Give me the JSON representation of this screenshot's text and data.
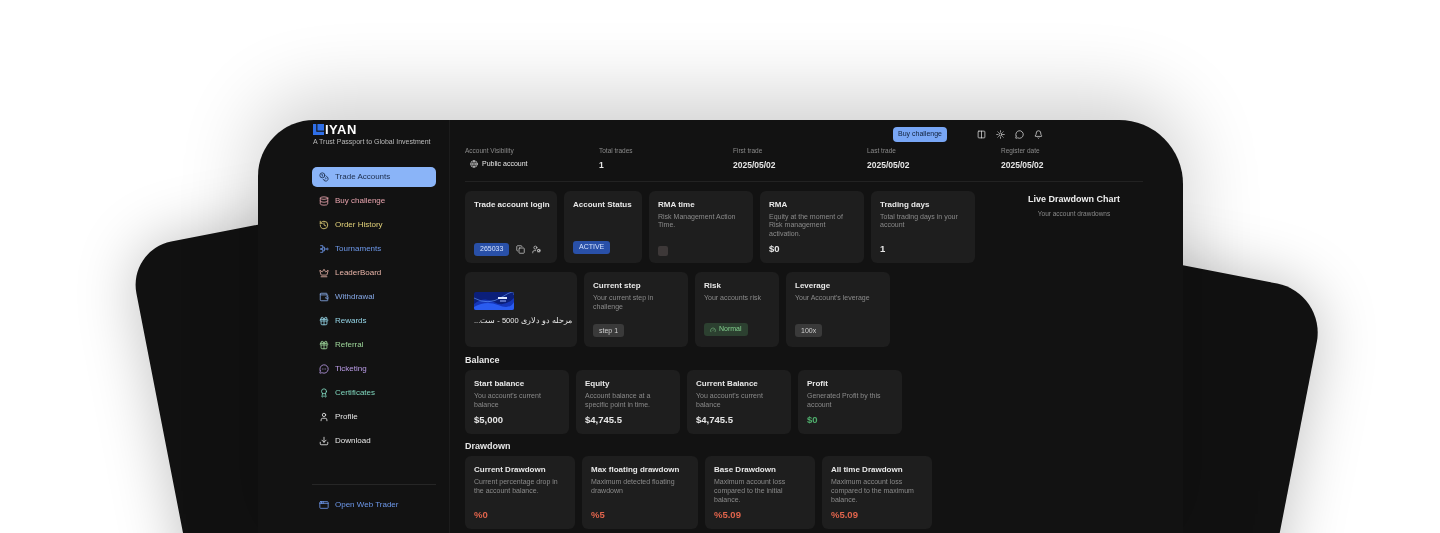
{
  "main": {
    "logo": {
      "name": "IYAN",
      "tagline": "A Trust Passport to Global Investment"
    },
    "sidebar": {
      "items": [
        {
          "label": "Trade Accounts",
          "selected": true
        },
        {
          "label": "Buy challenge",
          "selected": false
        },
        {
          "label": "Order History",
          "selected": false
        },
        {
          "label": "Tournaments",
          "selected": false
        },
        {
          "label": "LeaderBoard",
          "selected": false
        },
        {
          "label": "Withdrawal",
          "selected": false
        },
        {
          "label": "Rewards",
          "selected": false
        },
        {
          "label": "Referral",
          "selected": false
        },
        {
          "label": "Ticketing",
          "selected": false
        },
        {
          "label": "Certificates",
          "selected": false
        },
        {
          "label": "Profile",
          "selected": false
        },
        {
          "label": "Download",
          "selected": false
        }
      ],
      "footer": {
        "label": "Open Web Trader"
      }
    },
    "header": {
      "button": "Buy challenge"
    },
    "info": [
      {
        "kind": "visibility",
        "label": "Account Visibility",
        "value": "Public account"
      },
      {
        "kind": "text",
        "label": "Total trades",
        "value": "1"
      },
      {
        "kind": "text",
        "label": "First trade",
        "value": "2025/05/02"
      },
      {
        "kind": "text",
        "label": "Last trade",
        "value": "2025/05/02"
      },
      {
        "kind": "text",
        "label": "Register date",
        "value": "2025/05/02"
      }
    ],
    "cards_row_1": [
      {
        "kind": "login",
        "title": "Trade account login",
        "badge": "265033"
      },
      {
        "kind": "status",
        "title": "Account Status",
        "badge": "ACTIVE"
      },
      {
        "kind": "empty",
        "title": "RMA time",
        "description": "Risk Management Action Time."
      },
      {
        "kind": "value",
        "title": "RMA",
        "description": "Equity at the moment of Risk management activation.",
        "value": "$0"
      },
      {
        "kind": "value",
        "title": "Trading days",
        "description": "Total trading days in your account",
        "value": "1"
      }
    ],
    "cards_row_2": [
      {
        "kind": "picture",
        "caption": "مرحله دو دلاری 5000 - ست..."
      },
      {
        "kind": "badge",
        "title": "Current step",
        "description": "Your current step in challenge",
        "badge": "step 1"
      },
      {
        "kind": "risk",
        "title": "Risk",
        "description": "Your accounts risk",
        "badge": "Normal"
      },
      {
        "kind": "badge",
        "title": "Leverage",
        "description": "Your Account's leverage",
        "badge": "100x"
      }
    ],
    "balance": {
      "heading": "Balance",
      "cards": [
        {
          "kind": "value",
          "title": "Start balance",
          "description": "You account's current balance",
          "value": "$5,000"
        },
        {
          "kind": "value",
          "title": "Equity",
          "description": "Account balance at a specific point in time.",
          "value": "$4,745.5"
        },
        {
          "kind": "value",
          "title": "Current Balance",
          "description": "You account's current balance",
          "value": "$4,745.5"
        },
        {
          "kind": "gain",
          "title": "Profit",
          "description": "Generated Profit by this account",
          "value": "$0"
        }
      ]
    },
    "drawdown": {
      "heading": "Drawdown",
      "cards": [
        {
          "kind": "loss",
          "title": "Current Drawdown",
          "description": "Current percentage drop in the account balance.",
          "value": "%0"
        },
        {
          "kind": "loss",
          "title": "Max floating drawdown",
          "description": "Maximum detected floating drawdown",
          "value": "%5"
        },
        {
          "kind": "loss",
          "title": "Base Drawdown",
          "description": "Maximum account loss compared to the initial balance.",
          "value": "%5.09"
        },
        {
          "kind": "loss",
          "title": "All time Drawdown",
          "description": "Maximum account loss compared to the maximum balance.",
          "value": "%5.09"
        }
      ]
    },
    "chart": {
      "title": "Live Drawdown Chart",
      "subtitle": "Your account drawdowns"
    }
  }
}
